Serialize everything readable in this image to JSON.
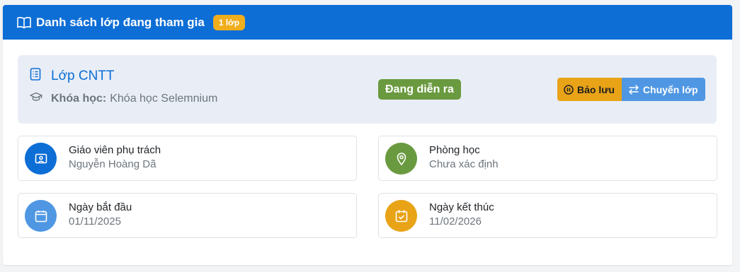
{
  "header": {
    "title": "Danh sách lớp đang tham gia",
    "badge": "1 lớp"
  },
  "class_item": {
    "name": "Lớp CNTT",
    "course_label": "Khóa học:",
    "course_value": "Khóa học Selemnium",
    "status": "Đang diễn ra",
    "actions": {
      "save_label": "Bảo lưu",
      "transfer_label": "Chuyển lớp"
    }
  },
  "details": {
    "teacher": {
      "label": "Giáo viên phụ trách",
      "value": "Nguyễn Hoàng Dã"
    },
    "room": {
      "label": "Phòng học",
      "value": "Chưa xác định"
    },
    "start_date": {
      "label": "Ngày bắt đầu",
      "value": "01/11/2025"
    },
    "end_date": {
      "label": "Ngày kết thúc",
      "value": "11/02/2026"
    }
  },
  "icons": {
    "header": "book-open-icon",
    "class": "list-icon",
    "course": "graduation-cap-icon",
    "save": "pause-circle-icon",
    "transfer": "arrows-exchange-icon",
    "teacher": "teacher-board-icon",
    "room": "map-pin-icon",
    "start": "calendar-icon",
    "end": "calendar-check-icon"
  },
  "colors": {
    "primary": "#0d6ed6",
    "badge": "#f0ad1c",
    "status": "#6a9a3f",
    "save_button": "#e8a317",
    "transfer_button": "#4f97e3",
    "teacher_circle": "#0d6ed6",
    "room_circle": "#6a9a3f",
    "start_circle": "#4f97e3",
    "end_circle": "#e8a317"
  }
}
